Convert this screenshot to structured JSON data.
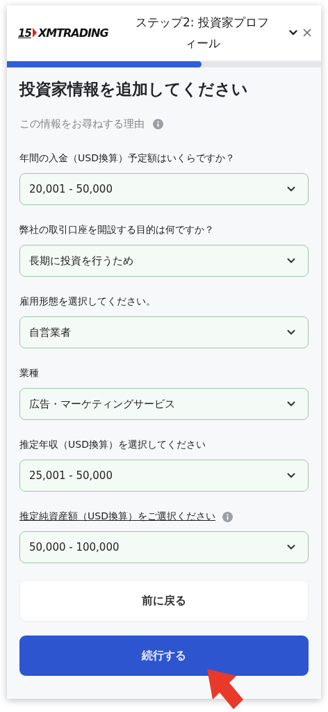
{
  "header": {
    "logo_number": "15",
    "logo_text": "XMTRADING",
    "title": "ステップ2: 投資家プロフィール"
  },
  "progress": {
    "level": 0.62
  },
  "heading": "投資家情報を追加してください",
  "reason": {
    "text": "この情報をお尋ねする理由",
    "info": true
  },
  "fields": [
    {
      "label": "年間の入金（USD換算）予定額はいくらですか？",
      "value": "20,001 - 50,000",
      "underlined": false,
      "info": false
    },
    {
      "label": "弊社の取引口座を開設する目的は何ですか？",
      "value": "長期に投資を行うため",
      "underlined": false,
      "info": false
    },
    {
      "label": "雇用形態を選択してください。",
      "value": "自営業者",
      "underlined": false,
      "info": false
    },
    {
      "label": "業種",
      "value": "広告・マーケティングサービス",
      "underlined": false,
      "info": false
    },
    {
      "label": "推定年収（USD換算）を選択してください",
      "value": "25,001 - 50,000",
      "underlined": false,
      "info": false
    },
    {
      "label": "推定純資産額（USD換算）をご選択ください",
      "value": "50,000 - 100,000",
      "underlined": true,
      "info": true
    }
  ],
  "buttons": {
    "back": "前に戻る",
    "continue": "続行する"
  }
}
